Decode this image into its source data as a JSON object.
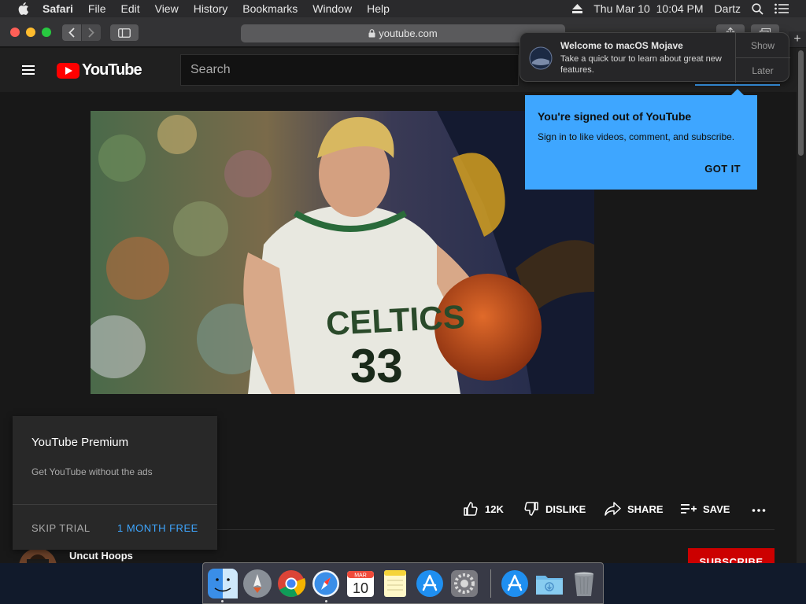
{
  "menubar": {
    "app": "Safari",
    "items": [
      "File",
      "Edit",
      "View",
      "History",
      "Bookmarks",
      "Window",
      "Help"
    ],
    "datetime": "Thu Mar 10  10:04 PM",
    "user": "Dartz"
  },
  "browser": {
    "url": "youtube.com"
  },
  "youtube": {
    "wordmark": "YouTube",
    "search_placeholder": "Search"
  },
  "notification": {
    "title": "Welcome to macOS Mojave",
    "body": "Take a quick tour to learn about great new features.",
    "show_label": "Show",
    "later_label": "Later"
  },
  "signed_out_tip": {
    "title": "You're signed out of YouTube",
    "body": "Sign in to like videos, comment, and subscribe.",
    "button": "GOT IT"
  },
  "premium": {
    "title": "YouTube Premium",
    "body": "Get YouTube without the ads",
    "skip_label": "SKIP TRIAL",
    "free_label": "1 MONTH FREE"
  },
  "actions": {
    "likes": "12K",
    "dislike": "DISLIKE",
    "share": "SHARE",
    "save": "SAVE"
  },
  "video": {
    "jersey_text": "CELTICS",
    "jersey_number": "33"
  },
  "channel": {
    "name": "Uncut Hoops",
    "subscribe_label": "SUBSCRIBE"
  },
  "colors": {
    "youtube_red": "#ff0000",
    "tooltip_blue": "#3ea6ff",
    "subscribe_red": "#cc0000"
  },
  "dock": {
    "icons": [
      "finder-icon",
      "launchpad-icon",
      "chrome-icon",
      "safari-icon",
      "calendar-icon",
      "notes-icon",
      "app-store-icon",
      "system-preferences-icon",
      "app-store-download-icon",
      "downloads-folder-icon",
      "trash-icon"
    ],
    "calendar_month": "MAR",
    "calendar_day": "10"
  }
}
